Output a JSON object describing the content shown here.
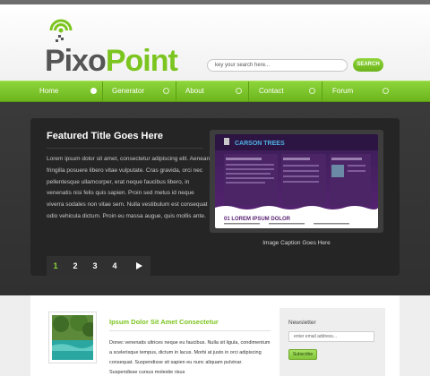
{
  "brand": {
    "logo_icon": "signal-target-icon",
    "name_part1": "Pixo",
    "name_part2": "Point",
    "colors": {
      "accent": "#7cc520",
      "dark": "#555555"
    }
  },
  "search": {
    "placeholder": "key your search here...",
    "button_label": "SEARCH"
  },
  "nav": {
    "items": [
      {
        "label": "Home",
        "active": true
      },
      {
        "label": "Generator",
        "active": false
      },
      {
        "label": "About",
        "active": false
      },
      {
        "label": "Contact",
        "active": false
      },
      {
        "label": "Forum",
        "active": false
      }
    ]
  },
  "featured": {
    "title": "Featured Title Goes Here",
    "body": "Lorem ipsum dolor sit amet, consectetur adipiscing elit. Aenean fringilla posuere libero vitae vulputate. Cras gravida, orci nec pellentesque ullamcorper, erat neque faucibus libero, in venenatis nisi felis quis sapien. Proin sed metus id neque viverra sodales non vitae sem. Nulla vestibulum est consequat odio vehicula dictum. Proin eu massa augue, quis mollis ante.",
    "image_caption": "Image Caption Goes Here",
    "preview_site_title": "CARSON TREES",
    "preview_heading": "01 LOREM IPSUM DOLOR"
  },
  "pager": {
    "pages": [
      "1",
      "2",
      "3",
      "4"
    ],
    "current": "1",
    "next_icon": "play-arrow-icon"
  },
  "post": {
    "title": "Ipsum Dolor Sit Amet Consectetur",
    "body": "Donec venenatis ultrices neque eu faucibus. Nulla sit ligula, condimentum a scelerisque tempus, dictum in lacus. Morbi at justo in orci adipiscing consequat. Suspendisse sit sapien eu nunc aliquam pulvinar. Suspendisse cursus molestie risus"
  },
  "newsletter": {
    "title": "Newsletter",
    "placeholder": "enter email address...",
    "button_label": "Subscribe"
  }
}
